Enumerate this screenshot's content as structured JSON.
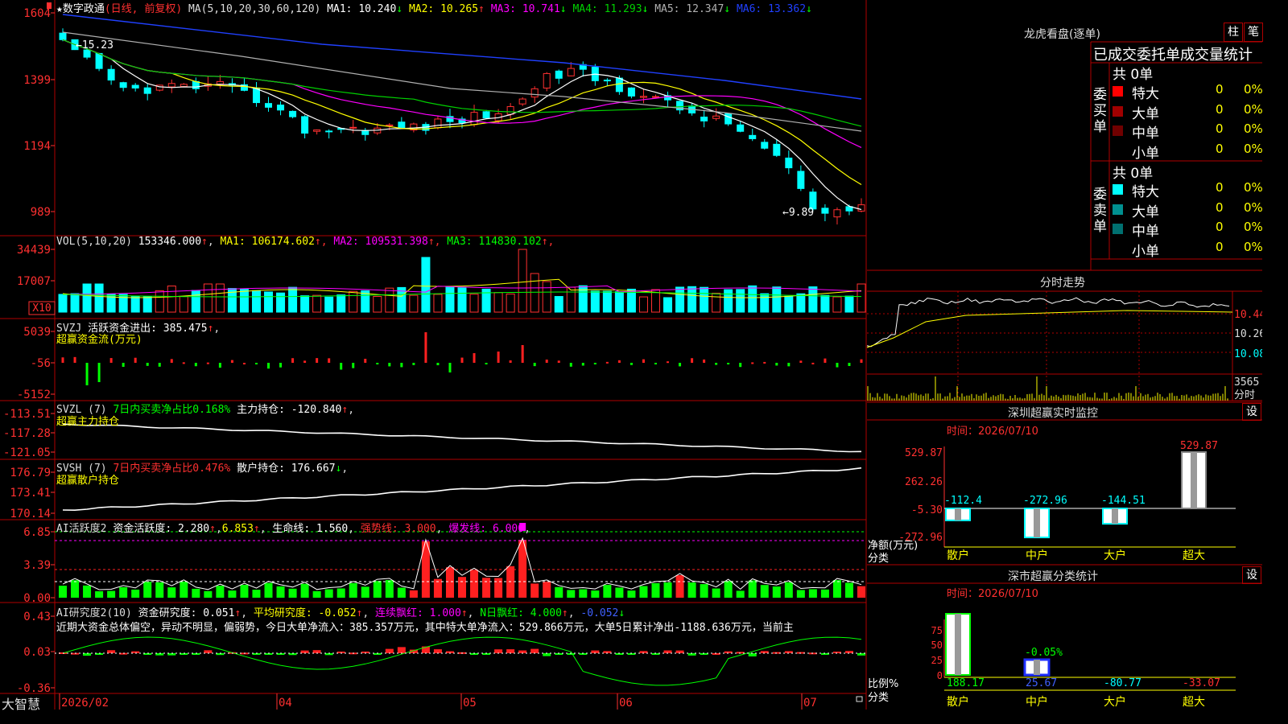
{
  "colors": {
    "up": "#ff3030",
    "down": "#00ffff",
    "grid": "#b00000",
    "ma1": "#ffffff",
    "ma2": "#ffff00",
    "ma3": "#ff00ff",
    "ma4": "#00d000",
    "ma5": "#b0b0b0",
    "ma6": "#2040ff",
    "green": "#00ff00",
    "yellow": "#ffff00",
    "magenta": "#ff00ff",
    "red": "#ff2020",
    "cyan": "#00ffff"
  },
  "brand": "大智慧",
  "lock_icon": "lock-icon",
  "main": {
    "star": "★",
    "name": "数字政通",
    "mode": "(日线, 前复权)",
    "ma_title": "MA(5,10,20,30,60,120)",
    "ma_values": [
      {
        "label": "MA1:",
        "value": "10.240",
        "arrow": "↓"
      },
      {
        "label": "MA2:",
        "value": "10.265",
        "arrow": "↑"
      },
      {
        "label": "MA3:",
        "value": "10.741",
        "arrow": "↓"
      },
      {
        "label": "MA4:",
        "value": "11.293",
        "arrow": "↓"
      },
      {
        "label": "MA5:",
        "value": "12.347",
        "arrow": "↓"
      },
      {
        "label": "MA6:",
        "value": "13.362",
        "arrow": "↓"
      }
    ],
    "y_ticks": [
      "1604",
      "1399",
      "1194",
      "989"
    ],
    "high_mark": "15.23",
    "low_mark": "9.89"
  },
  "vol": {
    "title": "VOL(5,10,20)",
    "value": "153346.000",
    "ma_values": [
      {
        "label": "MA1:",
        "value": "106174.602",
        "arrow": "↑"
      },
      {
        "label": "MA2:",
        "value": "109531.398",
        "arrow": "↑"
      },
      {
        "label": "MA3:",
        "value": "114830.102",
        "arrow": "↑"
      }
    ],
    "y_ticks": [
      "34439",
      "17007"
    ],
    "unit": "X10"
  },
  "svzj": {
    "title": "SVZJ",
    "label": "活跃资金进出:",
    "value": "385.475",
    "arrow": "↑",
    "sub": "超赢资金流(万元)",
    "y_ticks": [
      "5039",
      "-56",
      "-5152"
    ]
  },
  "svzl": {
    "title": "SVZL (7)",
    "label_a": "7日内买卖净占比0.168%",
    "label_b": "主力持仓:",
    "value": "-120.840",
    "arrow": "↑",
    "sub": "超赢主力持仓",
    "y_ticks": [
      "-113.51",
      "-117.28",
      "-121.05"
    ]
  },
  "svsh": {
    "title": "SVSH (7)",
    "label_a": "7日内买卖净占比0.476%",
    "label_b": "散户持仓:",
    "value": "176.667",
    "arrow": "↓",
    "sub": "超赢散户持仓",
    "y_ticks": [
      "176.79",
      "173.41",
      "170.14"
    ]
  },
  "ai1": {
    "title": "AI活跃度2",
    "label": "资金活跃度:",
    "value": "2.280",
    "arrow": "↑",
    "v2": "6.853",
    "arrow2": "↑",
    "life_label": "生命线:",
    "life": "1.560",
    "strong": "强势线: 3.000",
    "burst": "爆发线: 6.000",
    "y_ticks": [
      "6.85",
      "3.39",
      "0.00"
    ]
  },
  "ai2": {
    "title": "AI研究度2(10)",
    "label": "资金研究度:",
    "value": "0.051",
    "arrow": "↑",
    "avg": "平均研究度: -0.052",
    "arrow_a": "↑",
    "red_cont": "连续飘红: 1.000",
    "arrow_r": "↑",
    "nred": "N日飘红: 4.000",
    "arrow_n": "↑",
    "last": "-0.052",
    "arrow_l": "↓",
    "y_ticks": [
      "0.43",
      "0.03",
      "-0.36"
    ],
    "comment": "近期大资金总体偏空，异动不明显，偏弱势，今日大单净流入：385.357万元，其中特大单净流入：529.866万元，大单5日累计净出-1188.636万元，当前主"
  },
  "x_axis": [
    "2026/02",
    "04",
    "05",
    "06",
    "07"
  ],
  "right": {
    "lhb_title": "龙虎看盘(逐单)",
    "btn_bar": "柱",
    "btn_pen": "笔",
    "order_stats_title": "已成交委托单成交量统计",
    "buy_side": "委买单",
    "sell_side": "委卖单",
    "buy_total": "共 0单",
    "sell_total": "共 0单",
    "buy_rows": [
      {
        "name": "特大",
        "count": "0",
        "pct": "0%",
        "color": "#ff0000"
      },
      {
        "name": "大单",
        "count": "0",
        "pct": "0%",
        "color": "#a00000"
      },
      {
        "name": "中单",
        "count": "0",
        "pct": "0%",
        "color": "#700000"
      },
      {
        "name": "小单",
        "count": "0",
        "pct": "0%",
        "color": "#000000"
      }
    ],
    "sell_rows": [
      {
        "name": "特大",
        "count": "0",
        "pct": "0%",
        "color": "#00ffff"
      },
      {
        "name": "大单",
        "count": "0",
        "pct": "0%",
        "color": "#009090"
      },
      {
        "name": "中单",
        "count": "0",
        "pct": "0%",
        "color": "#007070"
      },
      {
        "name": "小单",
        "count": "0",
        "pct": "0%",
        "color": "#000000"
      }
    ],
    "intraday_title": "分时走势",
    "intraday_ticks": [
      "10.44",
      "10.26",
      "10.08"
    ],
    "intraday_vol": "3565",
    "intraday_unit": "分时",
    "monitor_title": "深圳超赢实时监控",
    "settings": "设",
    "monitor_time": "时间：2026/07/10",
    "monitor_ticks": [
      "529.87",
      "262.26",
      "-5.30",
      "-272.96"
    ],
    "monitor_ylabel": "净额(万元)",
    "monitor_xlabel": "分类",
    "class_stats_title": "深市超赢分类统计",
    "class_time": "时间：2026/07/10",
    "class_ticks": [
      "75",
      "50",
      "25",
      "0"
    ],
    "class_ylabel": "比例%",
    "class_xlabel": "分类"
  },
  "chart_data": [
    {
      "type": "candlestick",
      "title": "数字政通 (日线, 前复权)",
      "ylim": [
        9.5,
        16.3
      ],
      "series_ma": [
        "MA1",
        "MA2",
        "MA3",
        "MA4",
        "MA5",
        "MA6"
      ],
      "high": 15.23,
      "low": 9.89,
      "x_labels": [
        "2026/02",
        "04",
        "05",
        "06",
        "07"
      ]
    },
    {
      "type": "bar",
      "title": "深圳超赢实时监控",
      "categories": [
        "散户",
        "中户",
        "大户",
        "超大"
      ],
      "values": [
        -112.4,
        -272.96,
        -144.51,
        529.87
      ],
      "ylim": [
        -272.96,
        529.87
      ]
    },
    {
      "type": "bar",
      "title": "深市超赢分类统计",
      "categories": [
        "散户",
        "中户",
        "大户",
        "超大"
      ],
      "values": [
        188.17,
        25.67,
        -80.77,
        -33.07
      ],
      "annotation": "-0.05%",
      "ylim": [
        0,
        75
      ]
    }
  ]
}
